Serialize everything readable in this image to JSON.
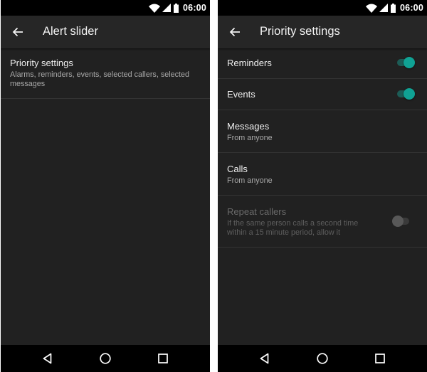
{
  "status_bar": {
    "time": "06:00"
  },
  "left_screen": {
    "title": "Alert slider",
    "items": [
      {
        "title": "Priority settings",
        "subtitle_lines": [
          "Alarms, reminders, events, selected callers, selected",
          "messages"
        ]
      }
    ]
  },
  "right_screen": {
    "title": "Priority settings",
    "items": [
      {
        "title": "Reminders",
        "toggle": "on"
      },
      {
        "title": "Events",
        "toggle": "on"
      },
      {
        "title": "Messages",
        "subtitle": "From anyone"
      },
      {
        "title": "Calls",
        "subtitle": "From anyone"
      },
      {
        "title": "Repeat callers",
        "subtitle_lines": [
          "If the same person calls a second time",
          "within a 15 minute period, allow it"
        ],
        "toggle": "off",
        "disabled": true
      }
    ]
  },
  "navigation_bar": {
    "buttons": [
      "back-icon",
      "home-icon",
      "recents-icon"
    ]
  },
  "colors": {
    "accent": "#10a294",
    "background": "#212121",
    "appbar": "#262626",
    "divider": "#333333"
  }
}
